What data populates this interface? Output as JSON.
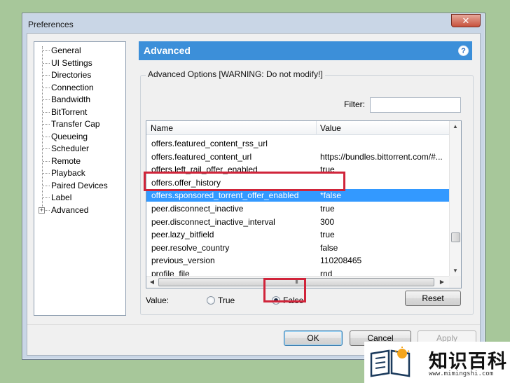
{
  "window": {
    "title": "Preferences",
    "close_glyph": "✕"
  },
  "sidebar": {
    "items": [
      {
        "label": "General"
      },
      {
        "label": "UI Settings"
      },
      {
        "label": "Directories"
      },
      {
        "label": "Connection"
      },
      {
        "label": "Bandwidth"
      },
      {
        "label": "BitTorrent"
      },
      {
        "label": "Transfer Cap"
      },
      {
        "label": "Queueing"
      },
      {
        "label": "Scheduler"
      },
      {
        "label": "Remote"
      },
      {
        "label": "Playback"
      },
      {
        "label": "Paired Devices"
      },
      {
        "label": "Label"
      },
      {
        "label": "Advanced"
      }
    ],
    "expander_glyph": "+"
  },
  "panel": {
    "title": "Advanced",
    "help_glyph": "?",
    "group_label": "Advanced Options [WARNING: Do not modify!]",
    "filter_label": "Filter:",
    "filter_value": ""
  },
  "table": {
    "columns": {
      "name": "Name",
      "value": "Value"
    },
    "rows": [
      {
        "name": "offers.featured_content_rss_url",
        "value": ""
      },
      {
        "name": "offers.featured_content_url",
        "value": "https://bundles.bittorrent.com/#..."
      },
      {
        "name": "offers.left_rail_offer_enabled",
        "value": "true"
      },
      {
        "name": "offers.offer_history",
        "value": ""
      },
      {
        "name": "offers.sponsored_torrent_offer_enabled",
        "value": "*false"
      },
      {
        "name": "peer.disconnect_inactive",
        "value": "true"
      },
      {
        "name": "peer.disconnect_inactive_interval",
        "value": "300"
      },
      {
        "name": "peer.lazy_bitfield",
        "value": "true"
      },
      {
        "name": "peer.resolve_country",
        "value": "false"
      },
      {
        "name": "previous_version",
        "value": "110208465"
      },
      {
        "name": "profile_file",
        "value": "rnd"
      }
    ],
    "selected_index": 4,
    "scroll_up_glyph": "▲",
    "scroll_down_glyph": "▼",
    "scroll_left_glyph": "◀",
    "scroll_right_glyph": "▶",
    "thumb_grip": "III"
  },
  "value_editor": {
    "label": "Value:",
    "true_label": "True",
    "false_label": "False",
    "selected": "False",
    "reset_label": "Reset"
  },
  "footer": {
    "ok_label": "OK",
    "cancel_label": "Cancel",
    "apply_label": "Apply"
  },
  "watermark": {
    "text": "知识百科",
    "url": "www.mimingshi.com"
  },
  "colors": {
    "accent": "#3c8fd9",
    "selection": "#3399ff",
    "highlight": "#d0243a",
    "background": "#a7c79a"
  }
}
